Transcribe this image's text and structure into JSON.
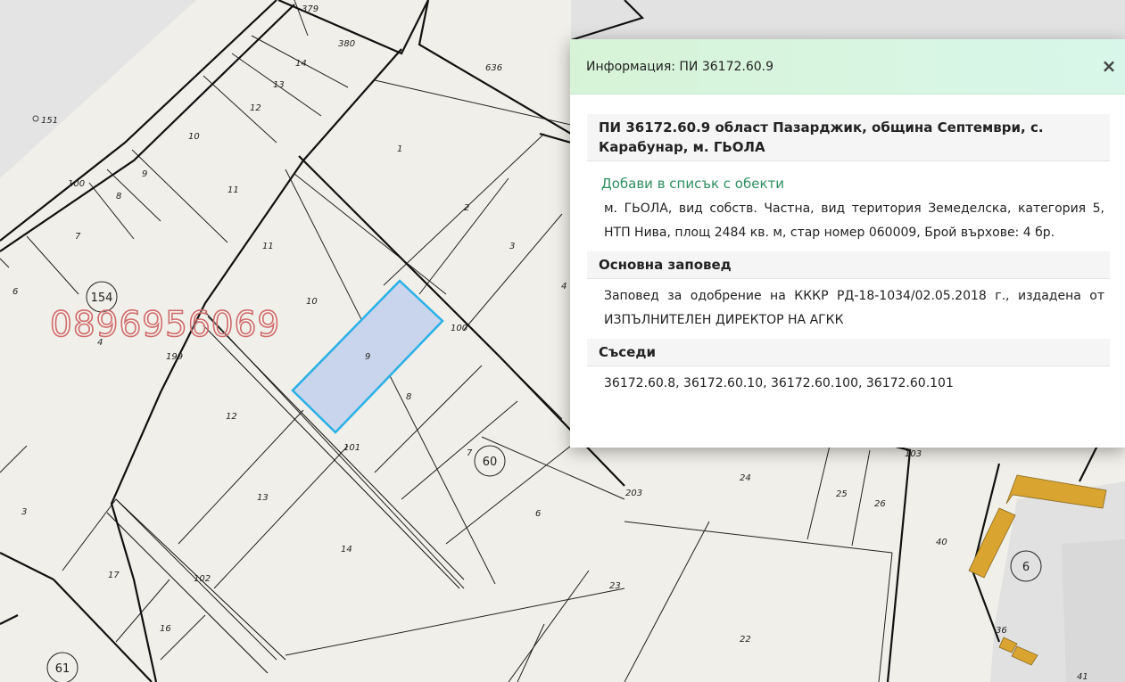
{
  "watermark": "0896956069",
  "map": {
    "circled_labels": [
      "154",
      "60",
      "6",
      "61"
    ],
    "parcel_labels": [
      {
        "name": "379"
      },
      {
        "name": "380"
      },
      {
        "name": "636"
      },
      {
        "name": "14"
      },
      {
        "name": "13"
      },
      {
        "name": "12"
      },
      {
        "name": "10"
      },
      {
        "name": "11"
      },
      {
        "name": "9"
      },
      {
        "name": "8"
      },
      {
        "name": "100"
      },
      {
        "name": "7"
      },
      {
        "name": "6"
      },
      {
        "name": "4"
      },
      {
        "name": "199"
      },
      {
        "name": "11"
      },
      {
        "name": "10"
      },
      {
        "name": "9"
      },
      {
        "name": "8"
      },
      {
        "name": "1"
      },
      {
        "name": "2"
      },
      {
        "name": "3"
      },
      {
        "name": "4"
      },
      {
        "name": "100"
      },
      {
        "name": "12"
      },
      {
        "name": "101"
      },
      {
        "name": "7"
      },
      {
        "name": "13"
      },
      {
        "name": "14"
      },
      {
        "name": "3"
      },
      {
        "name": "17"
      },
      {
        "name": "102"
      },
      {
        "name": "16"
      },
      {
        "name": "6"
      },
      {
        "name": "203"
      },
      {
        "name": "24"
      },
      {
        "name": "25"
      },
      {
        "name": "26"
      },
      {
        "name": "103"
      },
      {
        "name": "40"
      },
      {
        "name": "23"
      },
      {
        "name": "22"
      },
      {
        "name": "36"
      },
      {
        "name": "41"
      },
      {
        "name": "151"
      }
    ],
    "selected_parcel_color": "#c8d5ec",
    "selected_parcel_border": "#2ab0e6",
    "building_color": "#d9a430"
  },
  "popup": {
    "header_title": "Информация: ПИ 36172.60.9",
    "close_label": "×",
    "parcel_title": "ПИ 36172.60.9 област Пазарджик, община Септември, с. Карабунар, м. ГЬОЛА",
    "add_link": "Добави в списък с обекти",
    "details": "м. ГЬОЛА, вид собств. Частна, вид територия Земеделска, категория 5, НТП Нива, площ 2484 кв. м, стар номер 060009, Брой върхове: 4 бр.",
    "order_heading": "Основна заповед",
    "order_text": "Заповед за одобрение на КККР РД-18-1034/02.05.2018 г., издадена от ИЗПЪЛНИТЕЛЕН ДИРЕКТОР НА АГКК",
    "neighbours_heading": "Съседи",
    "neighbours_text": "36172.60.8, 36172.60.10, 36172.60.100, 36172.60.101"
  }
}
